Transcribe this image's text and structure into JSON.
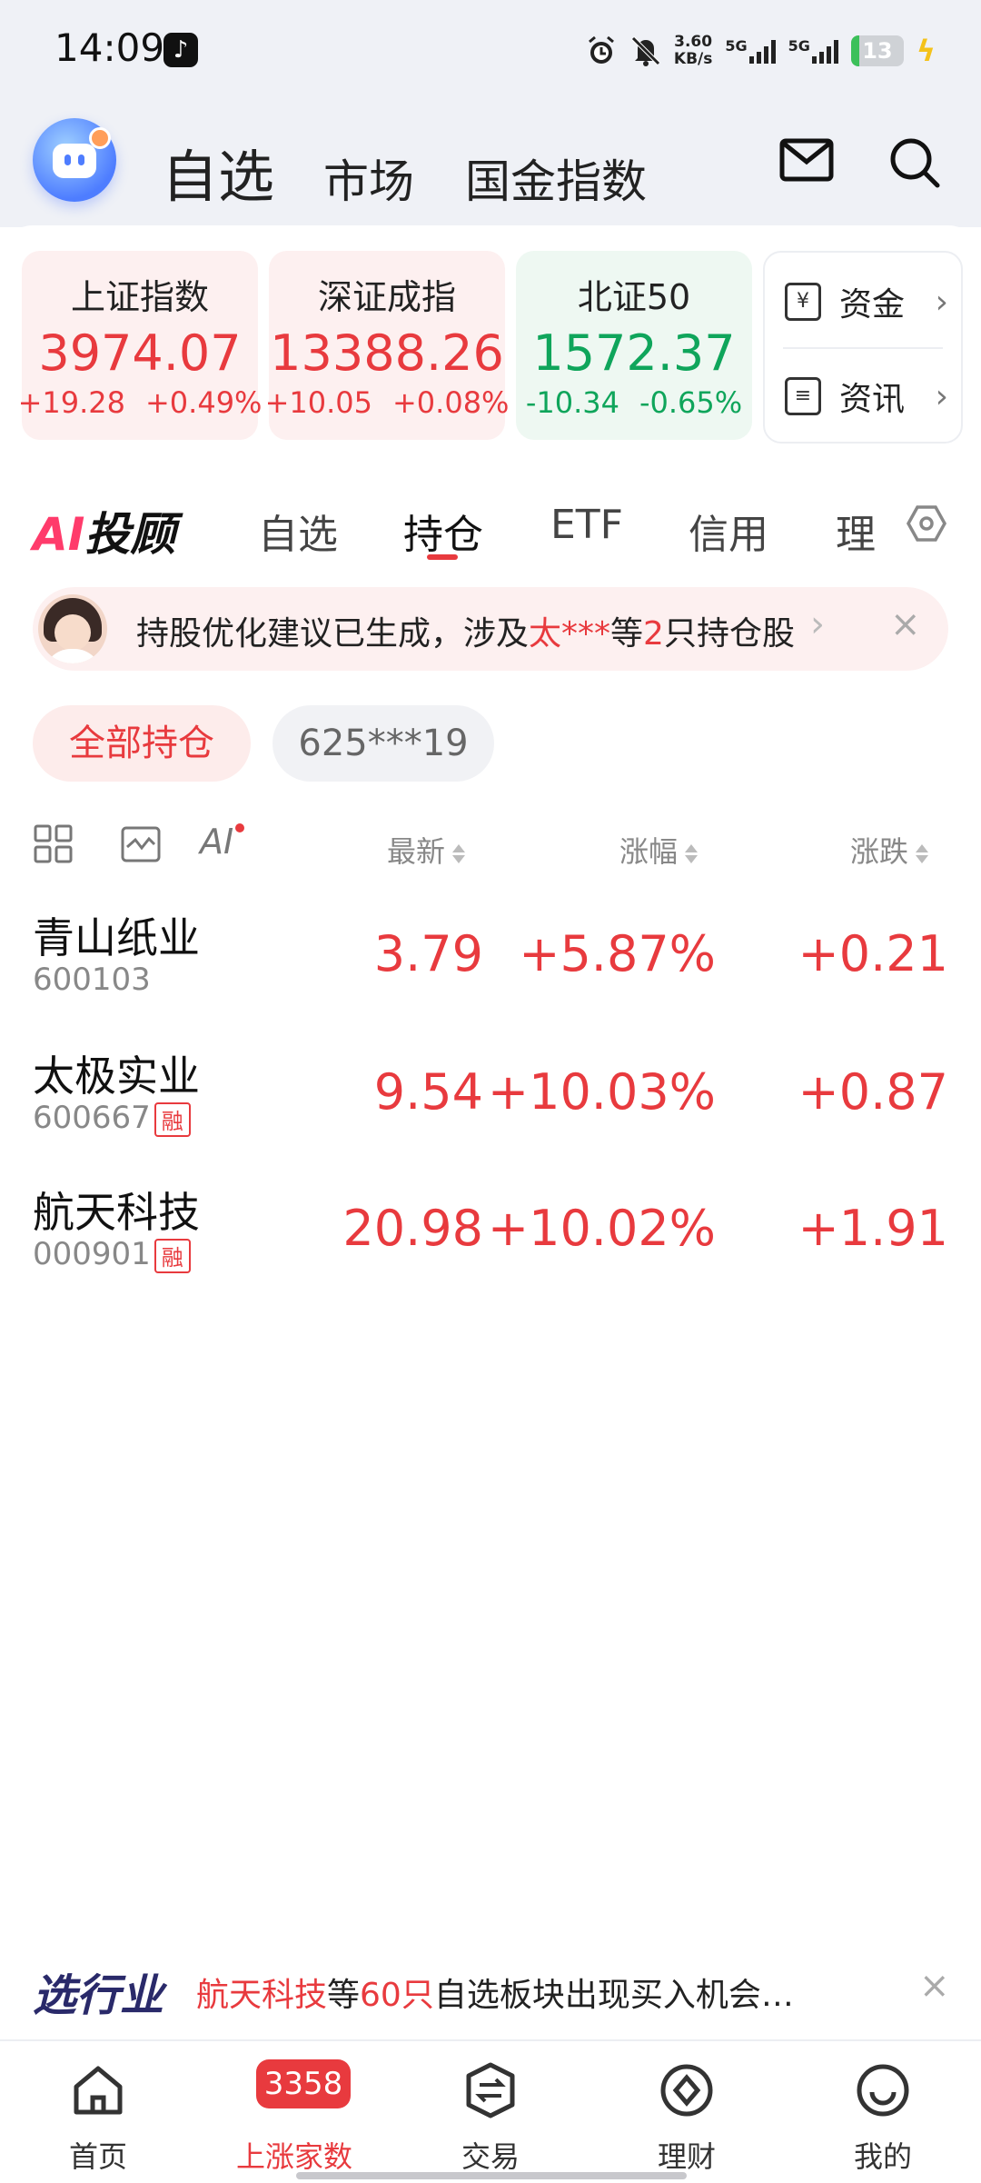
{
  "status_bar": {
    "time": "14:09",
    "net_speed_value": "3.60",
    "net_speed_unit": "KB/s",
    "network_1": "5G",
    "network_2": "5G",
    "battery": "13"
  },
  "header": {
    "tabs": [
      "自选",
      "市场",
      "国金指数"
    ],
    "active_tab": "自选"
  },
  "indices": [
    {
      "name": "上证指数",
      "value": "3974.07",
      "change": "+19.28",
      "percent": "+0.49%"
    },
    {
      "name": "深证成指",
      "value": "13388.26",
      "change": "+10.05",
      "percent": "+0.08%"
    },
    {
      "name": "北证50",
      "value": "1572.37",
      "change": "-10.34",
      "percent": "-0.65%"
    }
  ],
  "quick_links": [
    {
      "label": "资金",
      "icon": "yuan-wallet-icon"
    },
    {
      "label": "资讯",
      "icon": "document-icon"
    }
  ],
  "sub_tabs": {
    "ai_logo_a": "AI",
    "ai_logo_text": "投顾",
    "items": [
      "自选",
      "持仓",
      "ETF",
      "信用",
      "理"
    ],
    "active": "持仓"
  },
  "banner": {
    "prefix": "持股优化建议已生成，涉及",
    "highlight": "太***",
    "mid": "等",
    "count": "2",
    "suffix": "只持仓股"
  },
  "accounts": {
    "all_label": "全部持仓",
    "account_label": "625***19"
  },
  "table": {
    "headers": {
      "latest": "最新",
      "change_pct": "涨幅",
      "change": "涨跌"
    },
    "ai_icon_text": "AI",
    "margin_tag": "融",
    "rows": [
      {
        "name": "青山纸业",
        "code": "600103",
        "margin": false,
        "price": "3.79",
        "pct": "+5.87%",
        "chg": "+0.21"
      },
      {
        "name": "太极实业",
        "code": "600667",
        "margin": true,
        "price": "9.54",
        "pct": "+10.03%",
        "chg": "+0.87"
      },
      {
        "name": "航天科技",
        "code": "000901",
        "margin": true,
        "price": "20.98",
        "pct": "+10.02%",
        "chg": "+1.91"
      }
    ]
  },
  "promo": {
    "tag": "选行业",
    "highlight": "航天科技",
    "mid": "等",
    "count": "60只",
    "suffix": "自选板块出现买入机会…"
  },
  "tabbar": {
    "items": [
      "首页",
      "上涨家数",
      "交易",
      "理财",
      "我的"
    ],
    "badge": "3358",
    "active": "上涨家数"
  },
  "colors": {
    "up": "#e83a3e",
    "down": "#0fa55b",
    "accent": "#e83a3e"
  }
}
